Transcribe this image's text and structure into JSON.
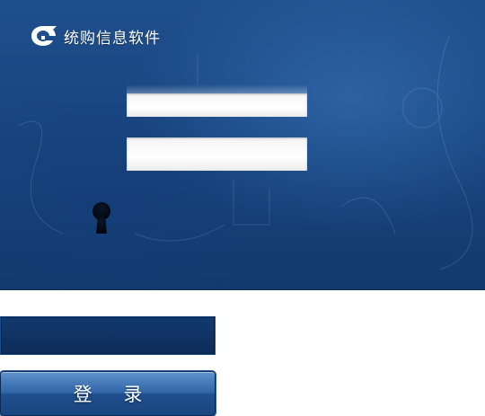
{
  "brand": {
    "name": "统购信息软件",
    "logo_icon": "brand-logo-icon"
  },
  "login_form": {
    "username_value": "",
    "password_value": "",
    "keyhole_icon": "keyhole-icon"
  },
  "login_button": {
    "label": "登 录"
  },
  "colors": {
    "panel_bg": "#1a4a86",
    "button_bg": "#2f65a6",
    "secondary_bg": "#0d2c58"
  }
}
